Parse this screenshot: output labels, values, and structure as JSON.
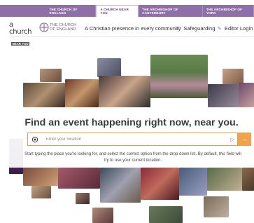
{
  "topnav": {
    "tabs": [
      {
        "label": "THE CHURCH OF ENGLAND",
        "active": false
      },
      {
        "label": "A CHURCH NEAR YOU",
        "active": true
      },
      {
        "label": "THE ARCHBISHOP OF CANTERBURY",
        "active": false
      },
      {
        "label": "THE ARCHBISHOP OF YORK",
        "active": false
      }
    ]
  },
  "header": {
    "logo_line1": "a church",
    "logo_line2": "NEAR YOU",
    "coe_line1": "THE CHURCH",
    "coe_line2": "OF ENGLAND",
    "tagline": "A Christian presence in every community",
    "safeguarding": "Safeguarding",
    "editor_login": "Editor Login"
  },
  "search": {
    "headline": "Find an event happening right now, near you.",
    "placeholder": "Enter your location",
    "help": "Start typing the place you're looking for, and select the correct option from the drop down list. By default, this field will try to use your current location.",
    "go_label": "→"
  },
  "colors": {
    "nav_purple": "#8e6fa8",
    "accent_orange": "#f0a34c",
    "brand_purple": "#7a5a9a"
  }
}
